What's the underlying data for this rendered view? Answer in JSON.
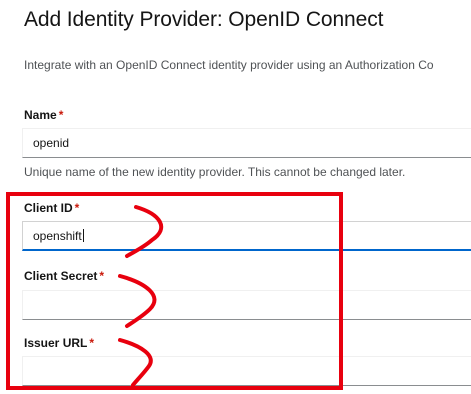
{
  "page": {
    "title": "Add Identity Provider: OpenID Connect",
    "subtitle": "Integrate with an OpenID Connect identity provider using an Authorization Co"
  },
  "form": {
    "name": {
      "label": "Name",
      "required_marker": "*",
      "value": "openid",
      "helper": "Unique name of the new identity provider. This cannot be changed later."
    },
    "client_id": {
      "label": "Client ID",
      "required_marker": "*",
      "value": "openshift"
    },
    "client_secret": {
      "label": "Client Secret",
      "required_marker": "*",
      "value": ""
    },
    "issuer_url": {
      "label": "Issuer URL",
      "required_marker": "*",
      "value": ""
    }
  },
  "annotation": {
    "color": "#e8000e"
  }
}
